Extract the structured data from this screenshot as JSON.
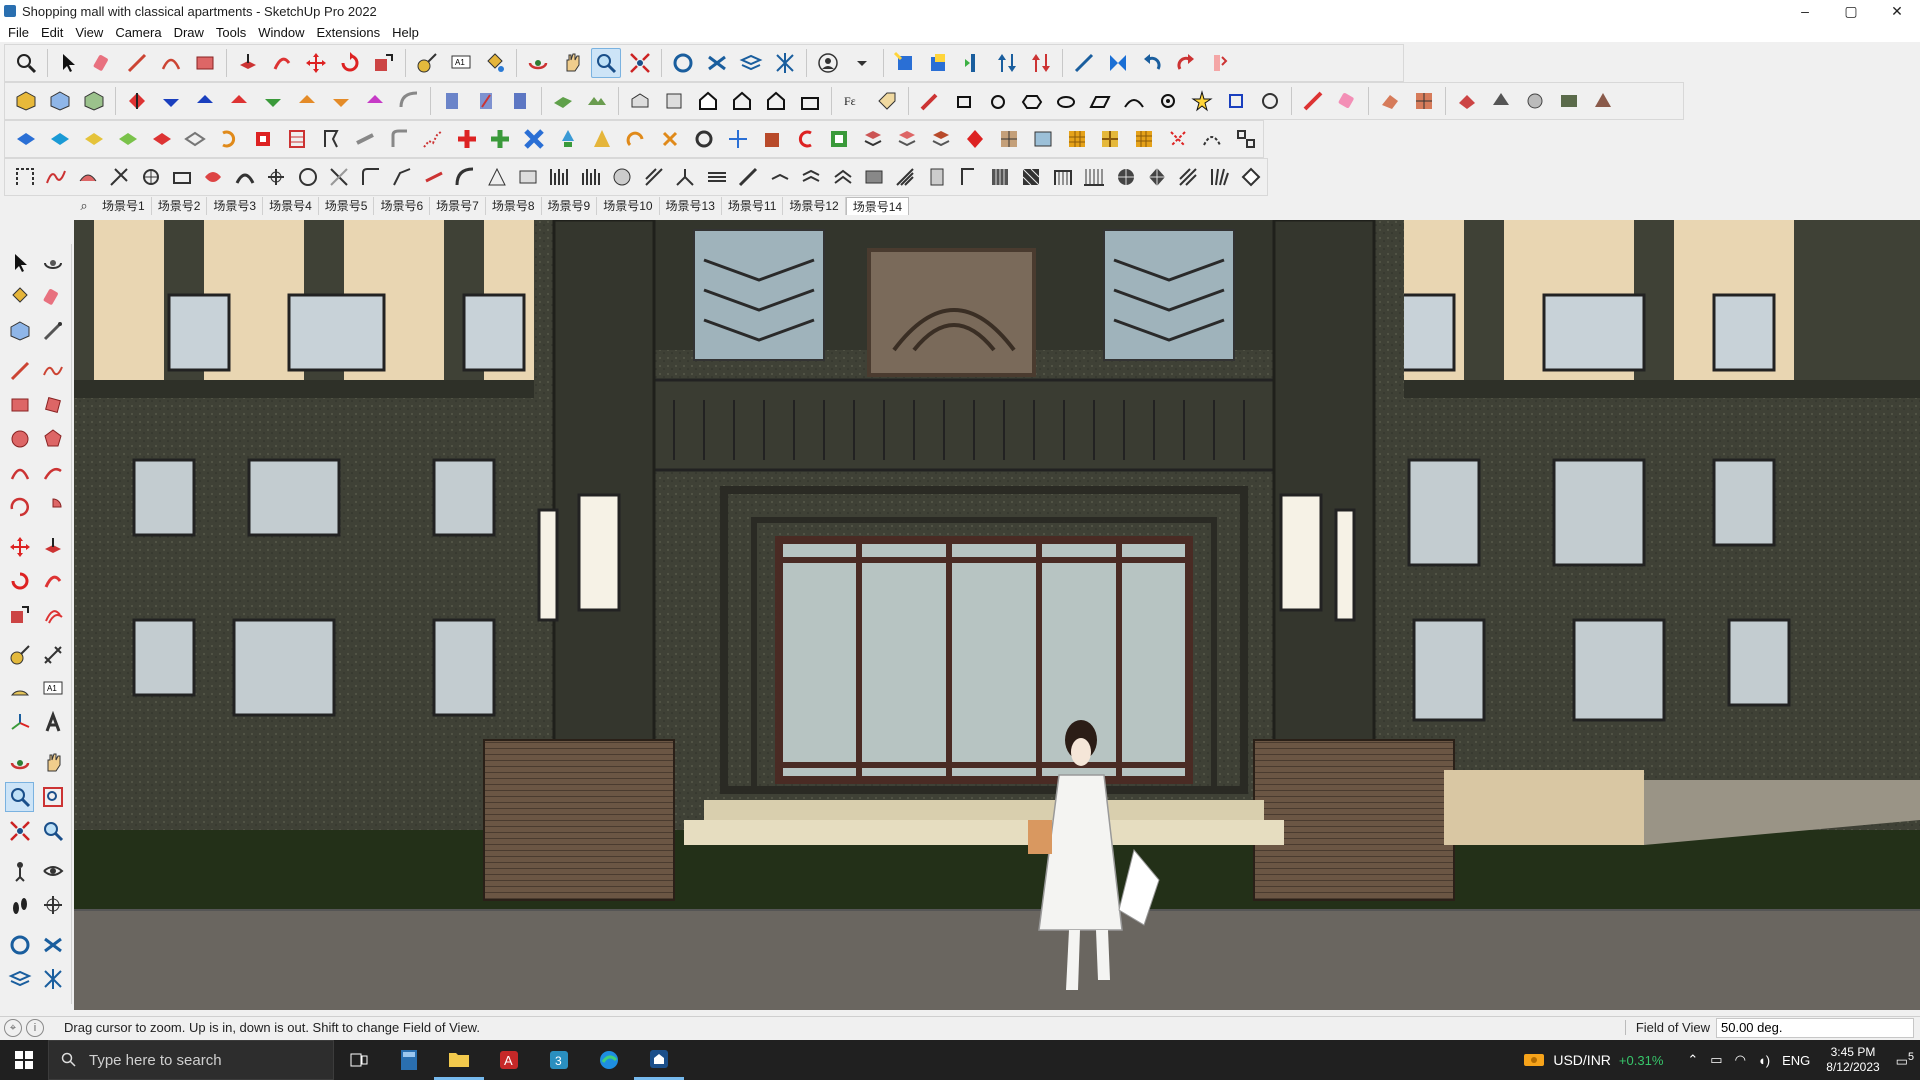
{
  "window": {
    "title": "Shopping mall with classical apartments - SketchUp Pro 2022",
    "minimize": "–",
    "maximize": "▢",
    "close": "✕"
  },
  "menu": [
    "File",
    "Edit",
    "View",
    "Camera",
    "Draw",
    "Tools",
    "Window",
    "Extensions",
    "Help"
  ],
  "scenes": {
    "tabs": [
      "场景号1",
      "场景号2",
      "场景号3",
      "场景号4",
      "场景号5",
      "场景号6",
      "场景号7",
      "场景号8",
      "场景号9",
      "场景号10",
      "场景号13",
      "场景号11",
      "场景号12",
      "场景号14"
    ],
    "active": "场景号14"
  },
  "status": {
    "hint": "Drag cursor to zoom.  Up is in, down is out. Shift to change Field of View.",
    "vcb_label": "Field of View",
    "vcb_value": "50.00 deg."
  },
  "taskbar": {
    "search_placeholder": "Type here to search",
    "ticker_pair": "USD/INR",
    "ticker_change": "+0.31%",
    "language": "ENG",
    "time": "3:45 PM",
    "date": "8/12/2023",
    "notifications": "5"
  },
  "colors": {
    "accent": "#cde4f7",
    "stone": "#3f4136",
    "beige": "#e9d6b2",
    "taskbar": "#202020",
    "ticker_up": "#37c56a"
  }
}
